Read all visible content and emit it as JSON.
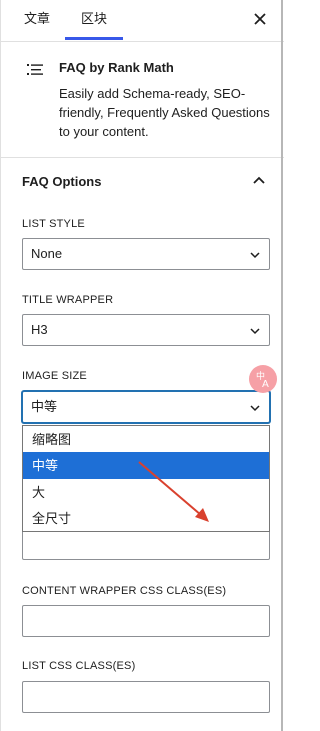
{
  "tabs": {
    "document": "文章",
    "block": "区块"
  },
  "block": {
    "title": "FAQ by Rank Math",
    "description": "Easily add Schema-ready, SEO-friendly, Frequently Asked Questions to your content."
  },
  "faq_options": {
    "title": "FAQ Options",
    "list_style": {
      "label": "LIST STYLE",
      "value": "None"
    },
    "title_wrapper": {
      "label": "TITLE WRAPPER",
      "value": "H3"
    },
    "image_size": {
      "label": "IMAGE SIZE",
      "value": "中等",
      "options": [
        "缩略图",
        "中等",
        "大",
        "全尺寸"
      ]
    },
    "content_wrapper_css": {
      "label": "CONTENT WRAPPER CSS CLASS(ES)",
      "value": ""
    },
    "list_css": {
      "label": "LIST CSS CLASS(ES)",
      "value": ""
    }
  },
  "colors": {
    "accent": "#3858e9",
    "selected_option": "#1e6fd6",
    "focus_border": "#2271b1",
    "arrow": "#d9412e",
    "badge": "#f6a0a6"
  }
}
